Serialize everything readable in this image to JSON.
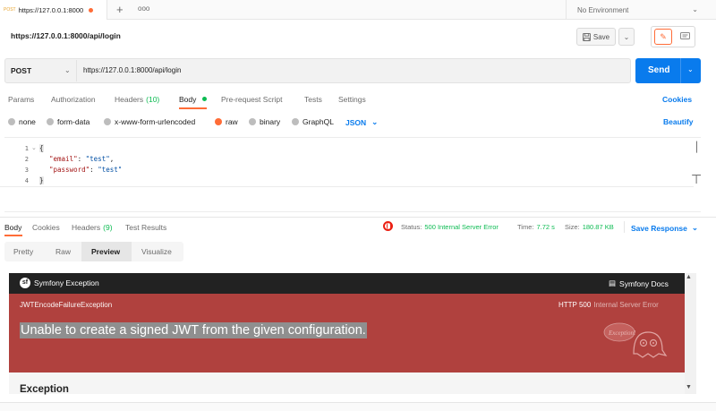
{
  "tabstrip": {
    "tab": {
      "method": "POST",
      "url": "https://127.0.0.1:8000"
    },
    "new_tab": "+",
    "more": "ooo",
    "environment": "No Environment"
  },
  "header": {
    "title": "https://127.0.0.1:8000/api/login",
    "save_label": "Save"
  },
  "request": {
    "method": "POST",
    "url": "https://127.0.0.1:8000/api/login",
    "send_label": "Send",
    "tabs": {
      "params": "Params",
      "authorization": "Authorization",
      "headers": "Headers",
      "headers_count": "(10)",
      "body": "Body",
      "prerequest": "Pre-request Script",
      "tests": "Tests",
      "settings": "Settings"
    },
    "cookies_link": "Cookies",
    "body_types": {
      "none": "none",
      "form_data": "form-data",
      "urlencoded": "x-www-form-urlencoded",
      "raw": "raw",
      "binary": "binary",
      "graphql": "GraphQL",
      "selected": "raw"
    },
    "raw_format": "JSON",
    "beautify_link": "Beautify",
    "code": {
      "line_numbers": [
        "1",
        "2",
        "3",
        "4"
      ],
      "open_brace": "{",
      "email_key": "\"email\"",
      "email_value": "\"test\"",
      "password_key": "\"password\"",
      "password_value": "\"test\"",
      "close_brace": "}",
      "colon": ": ",
      "comma": ","
    }
  },
  "response": {
    "tabs": {
      "body": "Body",
      "cookies": "Cookies",
      "headers": "Headers",
      "headers_count": "(9)",
      "test_results": "Test Results"
    },
    "status_label": "Status:",
    "status_value": "500 Internal Server Error",
    "time_label": "Time:",
    "time_value": "7.72 s",
    "size_label": "Size:",
    "size_value": "180.87 KB",
    "save_response": "Save Response",
    "view_tabs": {
      "pretty": "Pretty",
      "raw": "Raw",
      "preview": "Preview",
      "visualize": "Visualize",
      "selected": "Preview"
    },
    "preview": {
      "brand": "Symfony Exception",
      "docs": "Symfony Docs",
      "exception_class": "JWTEncodeFailureException",
      "http_code": "HTTP 500",
      "http_text": "Internal Server Error",
      "message": "Unable to create a signed JWT from the given configuration.",
      "ghost_text": "Exception!",
      "section_title": "Exception"
    }
  },
  "colors": {
    "accent_orange": "#ff6c37",
    "link_blue": "#097bed",
    "success_green": "#0cbb52",
    "error_red": "#b0413e"
  }
}
